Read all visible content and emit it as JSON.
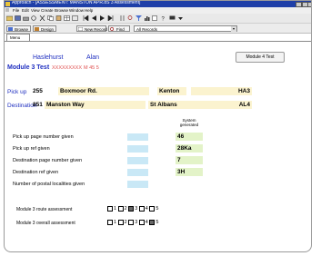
{
  "window": {
    "title": "Approach - [ASSESSMENT: MANSTON APR.8S 3 Assessment]"
  },
  "menu": [
    "File",
    "Edit",
    "View",
    "Create",
    "Browse",
    "Window",
    "Help"
  ],
  "toolbar2": {
    "browse_label": "Browse",
    "design_label": "Design",
    "new_record_label": "New Record",
    "find_label": "Find",
    "records_selected": "All Records"
  },
  "tab": {
    "label": "Menu"
  },
  "person": {
    "surname": "Haslehurst",
    "forename": "Alan"
  },
  "module": {
    "title": "Module 3 Test",
    "code1": "XXXXXXXXX",
    "code2": "M 45 5"
  },
  "module4_button": "Module 4 Test",
  "pickup": {
    "label": "Pick up",
    "number": "255",
    "street": "Boxmoor Rd.",
    "town": "Kenton",
    "postcode": "HA3"
  },
  "destination": {
    "label": "Destination",
    "number": "851",
    "street": "Manston Way",
    "town": "St Albans",
    "postcode": "AL4"
  },
  "system_generated_header": "System generated",
  "questions": [
    {
      "label": "Pick up page number given",
      "system": "46"
    },
    {
      "label": "Pick up ref given",
      "system": "28Ka"
    },
    {
      "label": "Destination page number given",
      "system": "7"
    },
    {
      "label": "Destination ref given",
      "system": "3H"
    },
    {
      "label": "Number of postal localities given",
      "system": ""
    }
  ],
  "assessments": [
    {
      "label": "Module 3 route assessment",
      "options": [
        {
          "label": "1",
          "checked": false
        },
        {
          "label": "2",
          "checked": false
        },
        {
          "label": "3",
          "checked": true
        },
        {
          "label": "4",
          "checked": false
        },
        {
          "label": "5",
          "checked": false
        }
      ]
    },
    {
      "label": "Module 3 overall assessment",
      "options": [
        {
          "label": "1",
          "checked": false
        },
        {
          "label": "2",
          "checked": false
        },
        {
          "label": "3",
          "checked": false
        },
        {
          "label": "4",
          "checked": false
        },
        {
          "label": "5",
          "checked": true
        }
      ]
    }
  ]
}
